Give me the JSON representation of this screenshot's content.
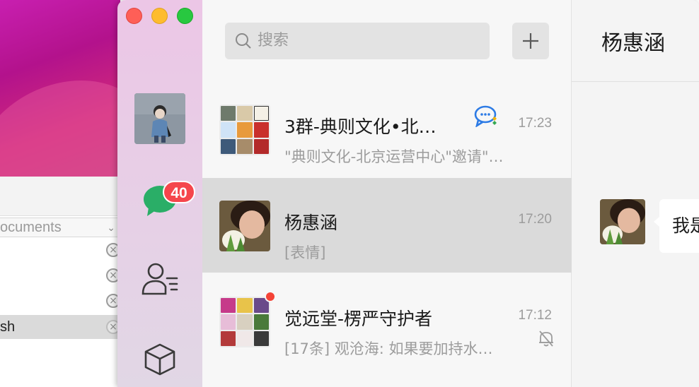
{
  "background": {
    "finder_path": "ocuments",
    "selected_row": "sh"
  },
  "sidebar": {
    "unread_badge": "40",
    "icons": [
      "chat-icon",
      "contacts-icon",
      "mini-program-box-icon"
    ]
  },
  "search": {
    "placeholder": "搜索"
  },
  "chats": [
    {
      "title": "3群-典则文化•北…",
      "time": "17:23",
      "preview": "\"典则文化-北京运营中心\"邀请\"…",
      "has_mention_icon": true
    },
    {
      "title": "杨惠涵",
      "time": "17:20",
      "preview": "[表情]",
      "selected": true
    },
    {
      "title": "觉远堂-楞严守护者",
      "time": "17:12",
      "preview": "[17条] 观沧海: 如果要加持水…",
      "muted": true,
      "unread_dot": true
    }
  ],
  "conversation": {
    "name": "杨惠涵",
    "message_preview": "我是"
  },
  "colors": {
    "accent_green": "#2aae67",
    "badge_red": "#f5464c",
    "selected_row": "#dadada"
  }
}
